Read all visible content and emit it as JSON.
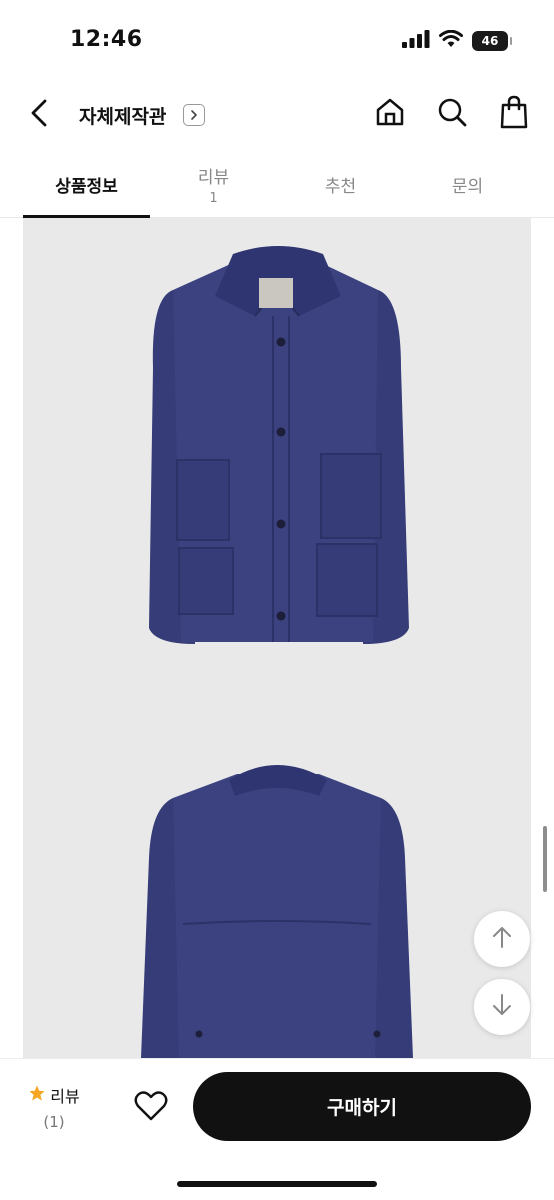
{
  "status_bar": {
    "time": "12:46",
    "battery": "46",
    "icons": [
      "signal-icon",
      "wifi-icon",
      "battery-icon"
    ]
  },
  "header": {
    "shop_name": "자체제작관",
    "icons": [
      "back-arrow-icon",
      "chevron-right-icon",
      "home-icon",
      "search-icon",
      "shopping-bag-icon"
    ]
  },
  "tabs": [
    {
      "label": "상품정보",
      "count": "",
      "active": true
    },
    {
      "label": "리뷰",
      "count": "1",
      "active": false
    },
    {
      "label": "추천",
      "count": "",
      "active": false
    },
    {
      "label": "문의",
      "count": "",
      "active": false
    }
  ],
  "product_images": {
    "background": "#e9e9ea",
    "jacket_color": "#39407e",
    "views": [
      "front",
      "back"
    ]
  },
  "floating_buttons": [
    "arrow-up-icon",
    "arrow-down-icon"
  ],
  "bottom_bar": {
    "review_label": "리뷰",
    "review_count": "(1)",
    "star_color": "#f5a623",
    "buy_label": "구매하기",
    "buy_button_color": "#111111"
  }
}
